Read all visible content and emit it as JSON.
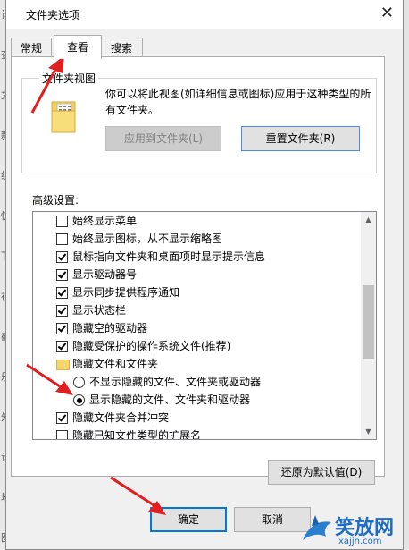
{
  "dialog": {
    "title": "文件夹选项",
    "close_glyph": "✕"
  },
  "tabs": [
    {
      "label": "常规",
      "active": false
    },
    {
      "label": "查看",
      "active": true
    },
    {
      "label": "搜索",
      "active": false
    }
  ],
  "folder_views": {
    "group_label": "文件夹视图",
    "description": "你可以将此视图(如详细信息或图标)应用于这种类型的所有文件夹。",
    "apply_button": "应用到文件夹(L)",
    "reset_button": "重置文件夹(R)"
  },
  "advanced": {
    "label": "高级设置:",
    "items": [
      {
        "type": "checkbox",
        "checked": false,
        "label": "始终显示菜单"
      },
      {
        "type": "checkbox",
        "checked": false,
        "label": "始终显示图标，从不显示缩略图"
      },
      {
        "type": "checkbox",
        "checked": true,
        "label": "鼠标指向文件夹和桌面项时显示提示信息"
      },
      {
        "type": "checkbox",
        "checked": true,
        "label": "显示驱动器号"
      },
      {
        "type": "checkbox",
        "checked": true,
        "label": "显示同步提供程序通知"
      },
      {
        "type": "checkbox",
        "checked": true,
        "label": "显示状态栏"
      },
      {
        "type": "checkbox",
        "checked": true,
        "label": "隐藏空的驱动器"
      },
      {
        "type": "checkbox",
        "checked": true,
        "label": "隐藏受保护的操作系统文件(推荐)"
      },
      {
        "type": "folder",
        "label": "隐藏文件和文件夹"
      },
      {
        "type": "radio",
        "checked": false,
        "label": "不显示隐藏的文件、文件夹或驱动器"
      },
      {
        "type": "radio",
        "checked": true,
        "label": "显示隐藏的文件、文件夹和驱动器"
      },
      {
        "type": "checkbox",
        "checked": true,
        "label": "隐藏文件夹合并冲突"
      },
      {
        "type": "checkbox",
        "checked": false,
        "label": "隐藏已知文件类型的扩展名"
      }
    ],
    "restore_button": "还原为默认值(D)"
  },
  "footer": {
    "ok_button": "确定",
    "cancel_button": "取消"
  },
  "watermark": {
    "text": "笑放网",
    "url": "xajjn.com"
  },
  "background_left_chars": [
    "计",
    "",
    "查",
    "",
    "文",
    "",
    "新",
    "",
    "组",
    "",
    "快",
    "",
    "下",
    "",
    "视",
    "",
    "截",
    "",
    "乐",
    "",
    "外",
    "",
    "计",
    "",
    "地",
    "",
    "图"
  ],
  "colors": {
    "accent": "#0078d7",
    "arrow": "#e02020"
  }
}
